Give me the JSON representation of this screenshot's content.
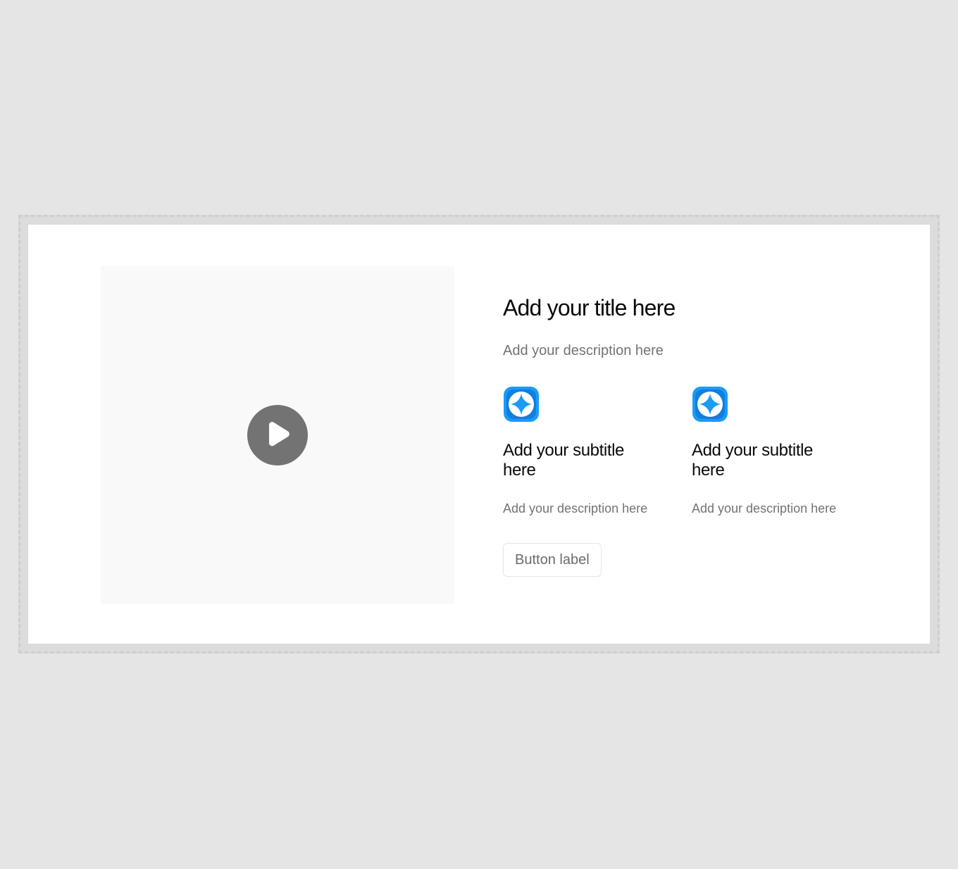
{
  "section": {
    "title": "Add your title here",
    "description": "Add your description here",
    "features": [
      {
        "icon": "sparkle-icon",
        "subtitle": "Add your subtitle here",
        "description": "Add your description here"
      },
      {
        "icon": "sparkle-icon",
        "subtitle": "Add your subtitle here",
        "description": "Add your description here"
      }
    ],
    "button_label": "Button label"
  },
  "video": {
    "icon": "play-icon"
  },
  "colors": {
    "page_background": "#e5e5e5",
    "card_background": "#ffffff",
    "video_placeholder": "#f9f9f9",
    "play_button": "#737373",
    "icon_accent": "#1a9cf5",
    "title_text": "#0a0a0a",
    "muted_text": "#737373"
  }
}
